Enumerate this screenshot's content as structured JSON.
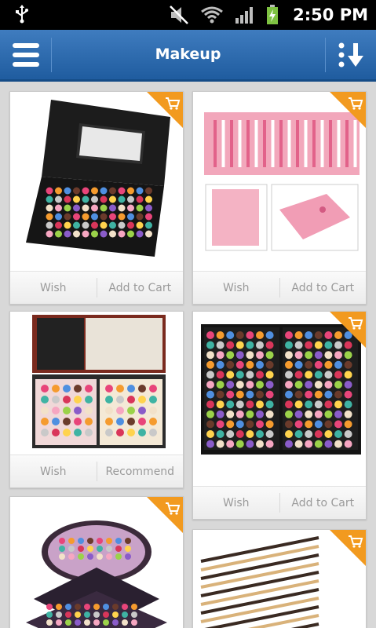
{
  "status_bar": {
    "time": "2:50 PM",
    "icons": [
      "usb-icon",
      "mute-icon",
      "wifi-icon",
      "signal-icon",
      "battery-charging-icon"
    ]
  },
  "app_bar": {
    "title": "Makeup",
    "left_icon": "menu-icon",
    "right_icon": "sort-icon"
  },
  "colors": {
    "app_bar": "#2a69ad",
    "cart_badge": "#f29a1f",
    "action_text": "#9a9a9a"
  },
  "products": [
    {
      "image": "makeup-palette-case",
      "has_cart_badge": true,
      "action_left": "Wish",
      "action_right": "Add to Cart"
    },
    {
      "image": "pink-brush-set",
      "has_cart_badge": true,
      "action_left": "Wish",
      "action_right": "Add to Cart"
    },
    {
      "image": "makeup-train-case",
      "has_cart_badge": false,
      "action_left": "Wish",
      "action_right": "Recommend"
    },
    {
      "image": "eyeshadow-palette",
      "has_cart_badge": true,
      "action_left": "Wish",
      "action_right": "Add to Cart"
    },
    {
      "image": "tiered-makeup-kit",
      "has_cart_badge": true
    },
    {
      "image": "wooden-brush-set",
      "has_cart_badge": true
    }
  ]
}
